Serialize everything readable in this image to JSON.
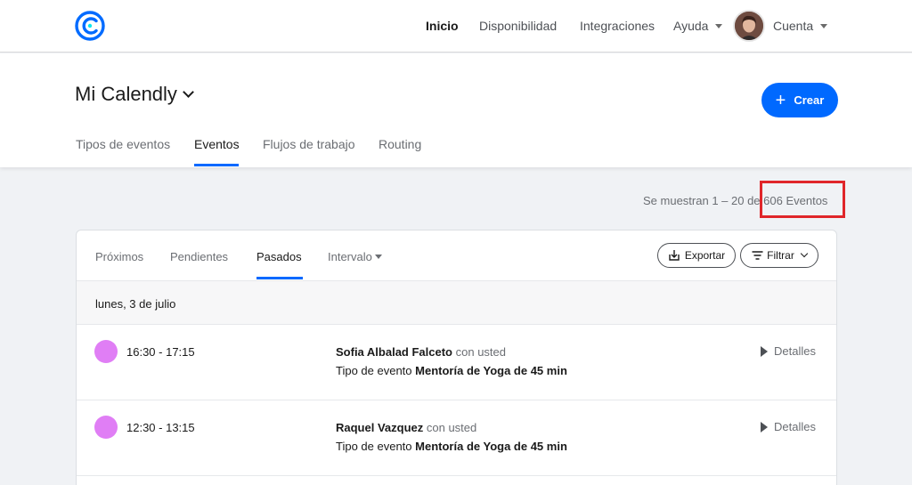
{
  "nav": {
    "items": [
      {
        "label": "Inicio",
        "active": true
      },
      {
        "label": "Disponibilidad"
      },
      {
        "label": "Integraciones"
      },
      {
        "label": "Ayuda"
      },
      {
        "label": "Cuenta"
      }
    ]
  },
  "header": {
    "title": "Mi Calendly",
    "create_label": "Crear",
    "tabs": [
      {
        "label": "Tipos de eventos"
      },
      {
        "label": "Eventos",
        "active": true
      },
      {
        "label": "Flujos de trabajo"
      },
      {
        "label": "Routing"
      }
    ]
  },
  "results": {
    "prefix": "Se muestran 1 – 20 de",
    "count": "606 Eventos"
  },
  "events_panel": {
    "tabs": [
      {
        "label": "Próximos"
      },
      {
        "label": "Pendientes"
      },
      {
        "label": "Pasados",
        "active": true
      },
      {
        "label": "Intervalo"
      }
    ],
    "export_label": "Exportar",
    "filter_label": "Filtrar",
    "date_header": "lunes, 3 de julio",
    "events": [
      {
        "time": "16:30 - 17:15",
        "name": "Sofia Albalad Falceto",
        "with": "con usted",
        "type_prefix": "Tipo de evento",
        "type": "Mentoría de Yoga de 45 min",
        "details_label": "Detalles"
      },
      {
        "time": "12:30 - 13:15",
        "name": "Raquel Vazquez",
        "with": "con usted",
        "type_prefix": "Tipo de evento",
        "type": "Mentoría de Yoga de 45 min",
        "details_label": "Detalles"
      }
    ]
  },
  "colors": {
    "accent": "#0069ff",
    "event_dot": "#e07ef5",
    "highlight": "#e0262a"
  }
}
